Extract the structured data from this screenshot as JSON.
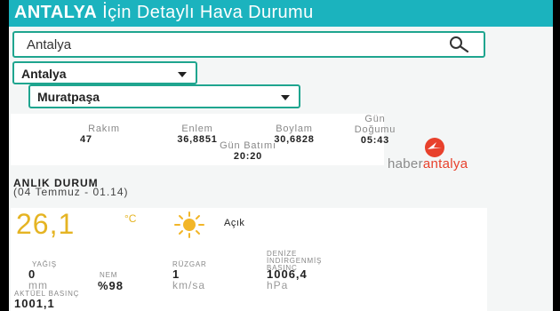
{
  "header": {
    "title_bold": "ANTALYA",
    "title_rest": "İçin Detaylı Hava Durumu"
  },
  "search": {
    "value": "Antalya",
    "icon": "search-icon"
  },
  "selects": {
    "city": "Antalya",
    "district": "Muratpaşa"
  },
  "location": {
    "altitude_label": "Rakım",
    "altitude_value": "47",
    "latitude_label": "Enlem",
    "latitude_value": "36,8851",
    "longitude_label": "Boylam",
    "longitude_value": "30,6828",
    "sunrise_label_1": "Gün",
    "sunrise_label_2": "Doğumu",
    "sunrise_value": "05:43",
    "sunset_label": "Gün Batımı",
    "sunset_value": "20:20"
  },
  "logo": {
    "part1": "haber",
    "part2": "antalya"
  },
  "current": {
    "title": "ANLIK DURUM",
    "date": "(04 Temmuz - 01.14)",
    "temperature": "26,1",
    "unit": "°C",
    "condition": "Açık",
    "condition_icon": "sun-icon"
  },
  "metrics": {
    "rain_label": "YAĞIŞ",
    "rain_value": "0",
    "rain_unit": "mm",
    "humidity_label": "NEM",
    "humidity_value": "%98",
    "wind_label": "RÜZGAR",
    "wind_value": "1",
    "wind_unit": "km/sa",
    "sea_pressure_label_1": "DENİZE",
    "sea_pressure_label_2": "İNDİRGENMİŞ",
    "sea_pressure_label_3": "BASINÇ",
    "sea_pressure_value": "1006,4",
    "sea_pressure_unit": "hPa",
    "actual_pressure_label": "AKTÜEL BASINÇ",
    "actual_pressure_value": "1001,1"
  },
  "colors": {
    "header": "#1bb3be",
    "border": "#1fa58f",
    "temperature": "#e5b423",
    "logo_red": "#e8412c"
  }
}
